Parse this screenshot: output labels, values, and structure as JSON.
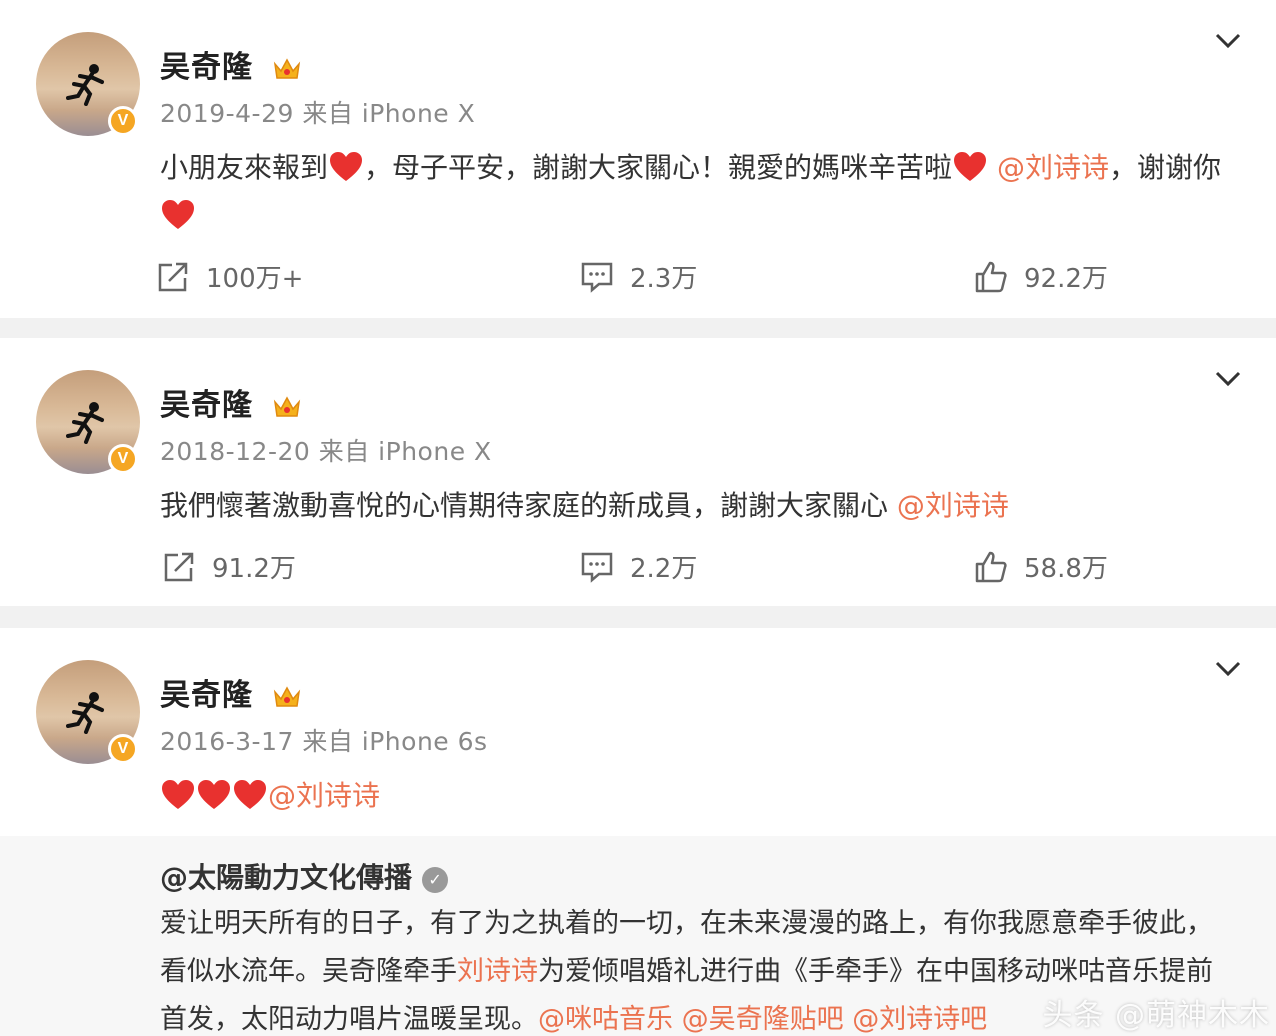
{
  "posts": [
    {
      "author": "吴奇隆",
      "meta": "2019-4-29 来自 iPhone X",
      "text_a": "小朋友來報到",
      "text_b": "，母子平安，謝謝大家關心！親愛的媽咪辛苦啦",
      "mention": "@刘诗诗",
      "text_c": "，谢谢你",
      "repost_count": "100万+",
      "comment_count": "2.3万",
      "like_count": "92.2万"
    },
    {
      "author": "吴奇隆",
      "meta": "2018-12-20 来自 iPhone X",
      "text_a": "我們懷著激動喜悅的心情期待家庭的新成員，謝謝大家關心 ",
      "mention": "@刘诗诗",
      "repost_count": "91.2万",
      "comment_count": "2.2万",
      "like_count": "58.8万"
    },
    {
      "author": "吴奇隆",
      "meta": "2016-3-17 来自 iPhone 6s",
      "mention": "@刘诗诗",
      "repost": {
        "author": "@太陽動力文化傳播",
        "text_a": "爱让明天所有的日子，有了为之执着的一切，在未来漫漫的路上，有你我愿意牵手彼此，看似水流年。吴奇隆牵手",
        "mention_a": "刘诗诗",
        "text_b": "为爱倾唱婚礼进行曲《手牵手》在中国移动咪咕音乐提前首发，太阳动力唱片温暖呈现。",
        "mention_b": "@咪咕音乐",
        "mention_c": "@吴奇隆贴吧",
        "mention_d": "@刘诗诗吧"
      }
    }
  ],
  "watermark": "头条 @萌神木木",
  "colors": {
    "mention": "#eb7350",
    "heart": "#e8312f",
    "badge": "#f5a623"
  },
  "icons": [
    "verified-badge-icon",
    "crown-icon",
    "chevron-down-icon",
    "repost-icon",
    "comment-icon",
    "like-icon",
    "heart-icon"
  ]
}
